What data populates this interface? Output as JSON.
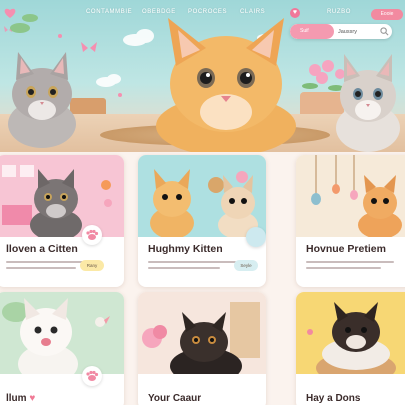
{
  "nav": {
    "links": [
      "CONTAMMBIE",
      "OBEBDGE",
      "POCROCES",
      "CLAIRS",
      "RUZBO"
    ],
    "cta_label": "Eooie"
  },
  "search": {
    "tab_label": "Suif",
    "value": "Jaussry"
  },
  "cards": [
    {
      "title": "lloven a Citten",
      "chip": "Rany"
    },
    {
      "title": "Hughmy Kitten",
      "chip": "Seyle"
    },
    {
      "title": "Hovnue Pretiem",
      "chip": ""
    },
    {
      "title": "llum",
      "chip": ""
    },
    {
      "title": "Your Caaur",
      "chip": ""
    },
    {
      "title": "Hay a Dons",
      "chip": ""
    }
  ],
  "colors": {
    "accent_pink": "#f28aa0",
    "sky_teal": "#9fd7d8",
    "card_bg": "#ffffff",
    "page_bg": "#fbf3ee"
  }
}
